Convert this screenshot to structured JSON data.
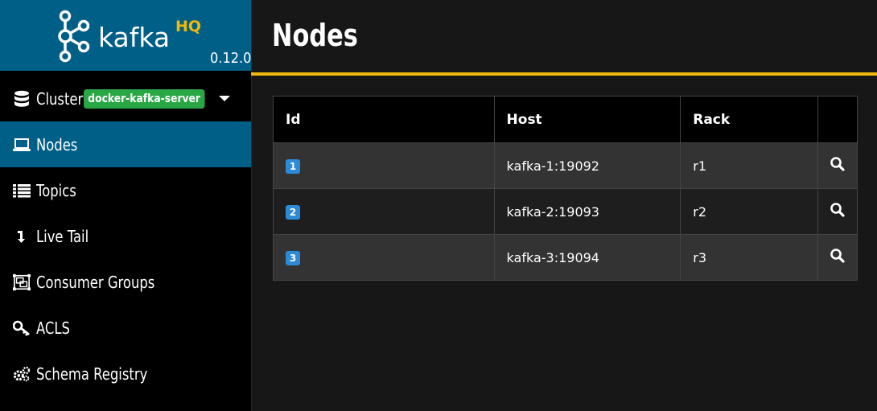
{
  "logo": {
    "word": "kafka",
    "hq": "HQ",
    "version": "0.12.0"
  },
  "sidebar": {
    "clusters_label": "Clusters",
    "cluster_badge": "docker-kafka-server",
    "items": [
      {
        "label": "Nodes",
        "icon": "laptop-icon",
        "active": true
      },
      {
        "label": "Topics",
        "icon": "list-icon"
      },
      {
        "label": "Live Tail",
        "icon": "arrow-down-icon"
      },
      {
        "label": "Consumer Groups",
        "icon": "object-group-icon"
      },
      {
        "label": "ACLS",
        "icon": "key-icon"
      },
      {
        "label": "Schema Registry",
        "icon": "cogs-icon"
      }
    ]
  },
  "header": {
    "title": "Nodes"
  },
  "table": {
    "columns": [
      "Id",
      "Host",
      "Rack",
      ""
    ],
    "rows": [
      {
        "id": "1",
        "host": "kafka-1:19092",
        "rack": "r1"
      },
      {
        "id": "2",
        "host": "kafka-2:19093",
        "rack": "r2"
      },
      {
        "id": "3",
        "host": "kafka-3:19094",
        "rack": "r3"
      }
    ]
  },
  "colors": {
    "brand_blue": "#005f87",
    "accent_yellow": "#f0b90b",
    "badge_green": "#29a745",
    "id_badge_blue": "#2c8ad8"
  }
}
